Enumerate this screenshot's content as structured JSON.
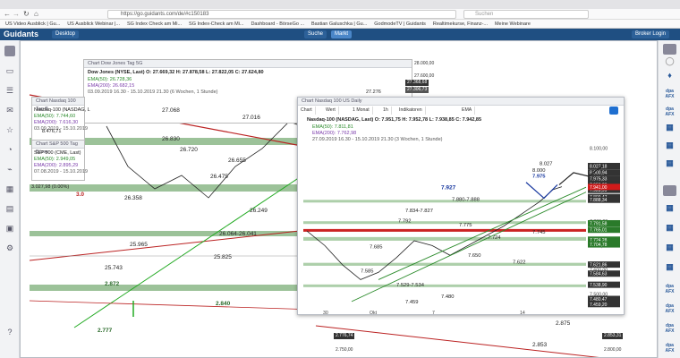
{
  "browser": {
    "url": "https://go.guidants.com/de/#c150183",
    "search_placeholder": "Suchen",
    "bookmarks": [
      "US Video Ausblick | Gu...",
      "US Ausblick Webinar |...",
      "SG Index Check am Mi...",
      "SG Index-Check am Mi...",
      "Dashboard - BörseGo ...",
      "Bastian Galuschka | Gu...",
      "GodmodeTV | Guidants",
      "Realtimekurse, Finanz-...",
      "Meine Webinare"
    ]
  },
  "app": {
    "logo": "Guidants",
    "desktop_label": "Desktop",
    "search_label": "Suche",
    "market_label": "Markt",
    "login_label": "Broker Login"
  },
  "windows": {
    "dow": {
      "title": "Chart Dow Jones Tag 5G",
      "header": "Dow Jones (NYSE, Last) O: 27.669,32 H: 27.878,58 L: 27.822,05 C: 27.624,80",
      "ema50": "EMA(50): 26.728,36",
      "ema200": "EMA(200): 26.682,15",
      "range": "03.09.2019 16.30 - 15.10.2019 21.30 (6 Wochen, 1 Stunde)"
    },
    "nasdaq_small": {
      "title": "Chart Nasdaq 100 Tag B",
      "header": "Nasdaq-100 (NASDAG, L",
      "ema50": "EMA(50): 7.744,60",
      "ema200": "EMA(200): 7.616,30",
      "range": "03.09.2019 - 15.10.2019"
    },
    "sp": {
      "title": "Chart S&P 500 Tag Börse",
      "header": "S&P 500 (CME, Last)",
      "ema50": "EMA(50): 2.949,05",
      "ema200": "EMA(200): 2.895,29",
      "range": "07.08.2019 - 15.10.2019"
    },
    "main": {
      "title": "Chart Nasdaq 100 US Daily",
      "toolbar": [
        "Chart",
        "Wert",
        "1 Monat",
        "1h",
        "Indikatoren",
        "EMA"
      ],
      "header": "Nasdaq-100 (NASDAG, Last) O: 7.951,75 H: 7.952,78 L: 7.938,85 C: 7.942,85",
      "ema50": "EMA(50): 7.811,81",
      "ema200": "EMA(200): 7.762,98",
      "range": "27.09.2019 16.30 - 15.10.2019 21.30 (3 Wochen, 1 Stunde)"
    }
  },
  "chart_data": {
    "type": "line",
    "title": "Nasdaq 100 US Daily",
    "xlabel": "",
    "ylabel": "",
    "x_ticks": [
      "30",
      "Okt",
      "7",
      "14"
    ],
    "y_ticks": [
      "8.100,00",
      "8.000,00",
      "7.900,00",
      "7.800,00",
      "7.700,00",
      "7.600,00",
      "7.500,00"
    ],
    "price_boxes": [
      "8.027,18",
      "8.000,94",
      "7.975,33",
      "7.950,23",
      "7.928,99",
      "7.899,47",
      "7.888,34",
      "7.941,00",
      "7.791,58",
      "7.765,01",
      "7.724,28",
      "7.704,78",
      "7.621,86",
      "7.584,63",
      "7.538,90",
      "7.480,47",
      "7.459,20"
    ],
    "annotations": [
      "8.027",
      "8.000",
      "7.975",
      "7.927",
      "7.880-7.888",
      "7.834-7.827",
      "7.792",
      "7.775",
      "7.724",
      "7.745",
      "7.685",
      "7.650",
      "7.622",
      "7.585",
      "7.529-7.534",
      "7.480",
      "7.459"
    ],
    "ylim": [
      7440,
      8110
    ]
  },
  "background_labels": {
    "dow_levels": [
      "27.068",
      "27.016",
      "26.830",
      "26.720",
      "26.655",
      "26.475",
      "26.358",
      "26.249",
      "26.064-26.041",
      "25.965",
      "25.825",
      "25.743"
    ],
    "dow_prices": [
      "28.000,00",
      "27.600,00",
      "27.368,68",
      "27.306,73",
      "27.276",
      "8.476,71",
      "3.027,98 (0.00%)",
      "3.0"
    ],
    "sp_levels": [
      "2.872",
      "2.840",
      "2.777",
      "2.875",
      "2.853",
      "2.776,74",
      "2.750,00",
      "2.853,31",
      "2.800,00"
    ]
  }
}
